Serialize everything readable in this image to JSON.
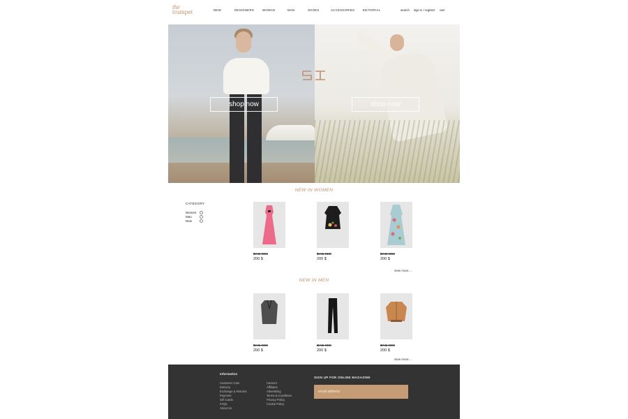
{
  "brand": {
    "line1": "the",
    "line2": "trumpet",
    "color": "#c0906a"
  },
  "nav": {
    "items": [
      "NEW",
      "DESIGNERS",
      "WOMAN",
      "MAN",
      "SHOES",
      "ACCESSORIES",
      "EDITORIAL"
    ],
    "search": "search",
    "signin": "sign in / register",
    "cart": "cart"
  },
  "hero": {
    "left_button": "shop now",
    "right_button": "shop now",
    "logo_mark": "ꞩꞩ"
  },
  "women": {
    "title": "NEW IN WOMEN",
    "products": [
      {
        "name": "BAG-XXX",
        "price": "200 $",
        "image": "pink-gown"
      },
      {
        "name": "BAG-XXX",
        "price": "200 $",
        "image": "black-embroidered-dress"
      },
      {
        "name": "BAG-XXX",
        "price": "200 $",
        "image": "floral-blue-gown"
      }
    ],
    "view_more": "view more...."
  },
  "category": {
    "title": "CATEGORY",
    "items": [
      "Women",
      "Man",
      "New"
    ]
  },
  "men": {
    "title": "NEW IN MEN",
    "products": [
      {
        "name": "BAG-XXX",
        "price": "200 $",
        "image": "grey-blazer"
      },
      {
        "name": "BAG-XXX",
        "price": "200 $",
        "image": "black-trousers"
      },
      {
        "name": "BAG-XXX",
        "price": "200 $",
        "image": "tan-bomber-jacket"
      }
    ],
    "view_more": "view more...."
  },
  "footer": {
    "info_title": "Information",
    "col1": [
      "Customer Care",
      "Delivery",
      "Exchange & Returns",
      "Payment",
      "Gift Cards",
      "FAQs",
      "About Us"
    ],
    "col2": [
      "Careers",
      "Affiliates",
      "Advertising",
      "Terms & Conditions",
      "Privacy Policy",
      "Cookie Policy"
    ],
    "signup_title": "SIGN UP FOR ONLINE MAGAZINE",
    "email_placeholder": "email address"
  },
  "colors": {
    "accent": "#c0906a",
    "footer_bg": "#333333",
    "email_bg": "#c69c74",
    "product_bg": "#e6e6e6"
  }
}
